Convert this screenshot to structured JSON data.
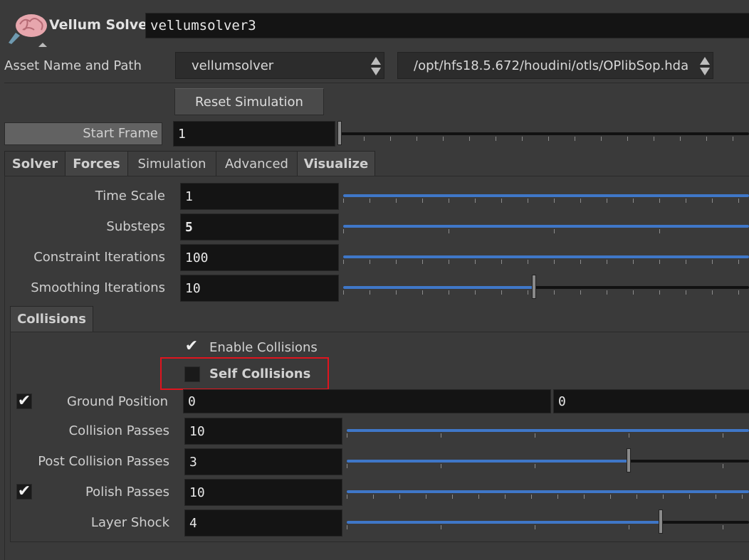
{
  "header": {
    "node_type": "Vellum Solver",
    "node_name": "vellumsolver3",
    "node_icon": "brain-icon"
  },
  "asset": {
    "label": "Asset Name and Path",
    "name": "vellumsolver",
    "path": "/opt/hfs18.5.672/houdini/otls/OPlibSop.hda"
  },
  "reset_button": "Reset Simulation",
  "start_frame": {
    "label": "Start Frame",
    "value": "1"
  },
  "tabs": [
    {
      "label": "Solver",
      "active": true
    },
    {
      "label": "Forces"
    },
    {
      "label": "Simulation"
    },
    {
      "label": "Advanced"
    },
    {
      "label": "Visualize"
    }
  ],
  "solver_params": [
    {
      "label": "Time Scale",
      "value": "1",
      "slider_fraction": 1.0
    },
    {
      "label": "Substeps",
      "value": "5",
      "slider_fraction": 1.0
    },
    {
      "label": "Constraint Iterations",
      "value": "100",
      "slider_fraction": 1.0
    },
    {
      "label": "Smoothing Iterations",
      "value": "10",
      "slider_fraction": 0.47
    }
  ],
  "collisions": {
    "tab_label": "Collisions",
    "enable_collisions": {
      "label": "Enable Collisions",
      "checked": true
    },
    "self_collisions": {
      "label": "Self Collisions",
      "checked": false
    },
    "ground_position": {
      "label": "Ground Position",
      "values": [
        "0",
        "0"
      ],
      "enabled": true
    },
    "params": [
      {
        "label": "Collision Passes",
        "value": "10",
        "slider_fraction": 1.0
      },
      {
        "label": "Post Collision Passes",
        "value": "3",
        "slider_fraction": 0.7
      },
      {
        "label": "Polish Passes",
        "value": "10",
        "slider_fraction": 1.0,
        "enabled": true
      },
      {
        "label": "Layer Shock",
        "value": "4",
        "slider_fraction": 0.78
      }
    ]
  },
  "highlight_color": "#e0141e",
  "accent_color": "#3f77c8"
}
